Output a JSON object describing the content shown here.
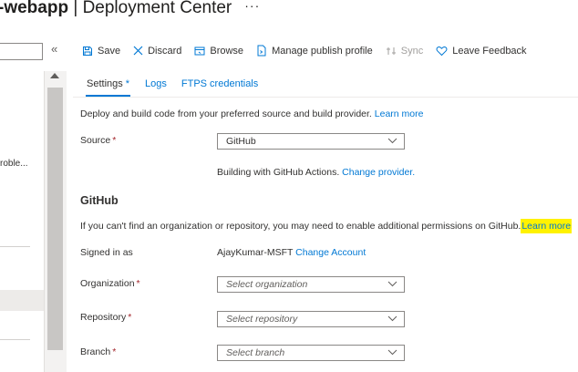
{
  "header": {
    "app_name": "-webapp",
    "separator": " | ",
    "page_title": "Deployment Center",
    "more": "···"
  },
  "left_panel": {
    "collapse": "«",
    "snippet": "roble..."
  },
  "toolbar": {
    "save": "Save",
    "discard": "Discard",
    "browse": "Browse",
    "manage_publish_profile": "Manage publish profile",
    "sync": "Sync",
    "leave_feedback": "Leave Feedback"
  },
  "tabs": [
    {
      "label": "Settings",
      "marker": "*"
    },
    {
      "label": "Logs"
    },
    {
      "label": "FTPS credentials"
    }
  ],
  "intro": {
    "text": "Deploy and build code from your preferred source and build provider.",
    "link": "Learn more"
  },
  "source": {
    "label": "Source",
    "value": "GitHub"
  },
  "build": {
    "text": "Building with GitHub Actions.",
    "link": "Change provider."
  },
  "github": {
    "title": "GitHub",
    "permissions_text": "If you can't find an organization or repository, you may need to enable additional permissions on GitHub.",
    "permissions_link": "Learn more",
    "signed_in_label": "Signed in as",
    "signed_in_user": "AjayKumar-MSFT",
    "change_account": "Change Account"
  },
  "fields": {
    "organization": {
      "label": "Organization",
      "placeholder": "Select organization"
    },
    "repository": {
      "label": "Repository",
      "placeholder": "Select repository"
    },
    "branch": {
      "label": "Branch",
      "placeholder": "Select branch"
    }
  },
  "required_marker": "*",
  "colors": {
    "accent": "#0078d4",
    "required": "#a4262c",
    "highlight": "#fff200"
  }
}
